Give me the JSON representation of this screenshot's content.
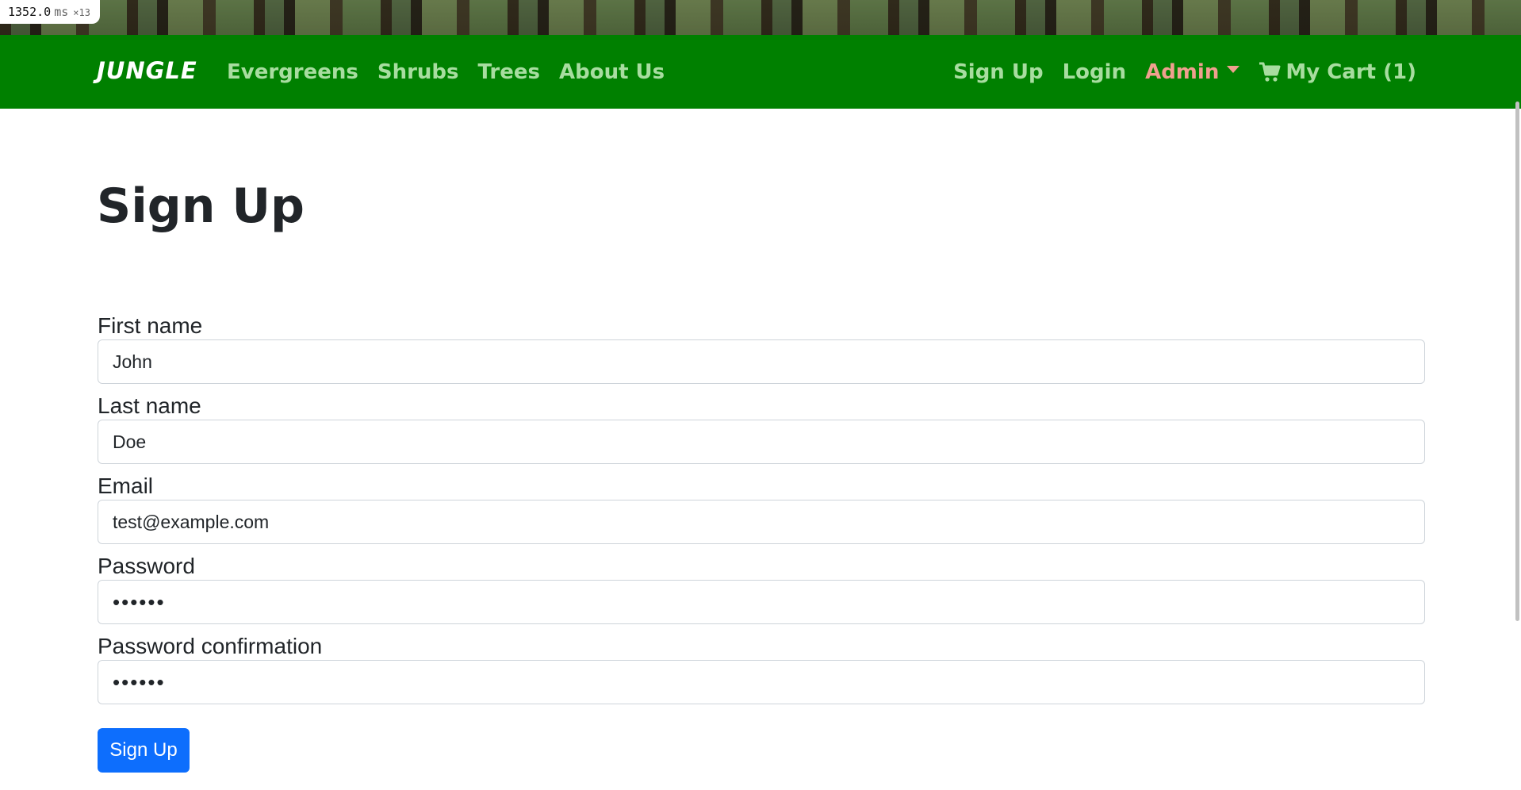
{
  "perf_badge": {
    "value": "1352.0",
    "unit": "ms",
    "multiplier": "×13"
  },
  "navbar": {
    "brand": "JUNGLE",
    "left_links": [
      "Evergreens",
      "Shrubs",
      "Trees",
      "About Us"
    ],
    "signup": "Sign Up",
    "login": "Login",
    "admin": "Admin",
    "cart": "My Cart (1)",
    "colors": {
      "background": "#008000",
      "link": "#a8dda0",
      "admin": "#f0a08f"
    }
  },
  "page": {
    "title": "Sign Up"
  },
  "form": {
    "first_name": {
      "label": "First name",
      "value": "John"
    },
    "last_name": {
      "label": "Last name",
      "value": "Doe"
    },
    "email": {
      "label": "Email",
      "value": "test@example.com"
    },
    "password": {
      "label": "Password",
      "value": "••••••"
    },
    "password_confirmation": {
      "label": "Password confirmation",
      "value": "••••••"
    },
    "submit_label": "Sign Up",
    "submit_color": "#0d6efd"
  }
}
